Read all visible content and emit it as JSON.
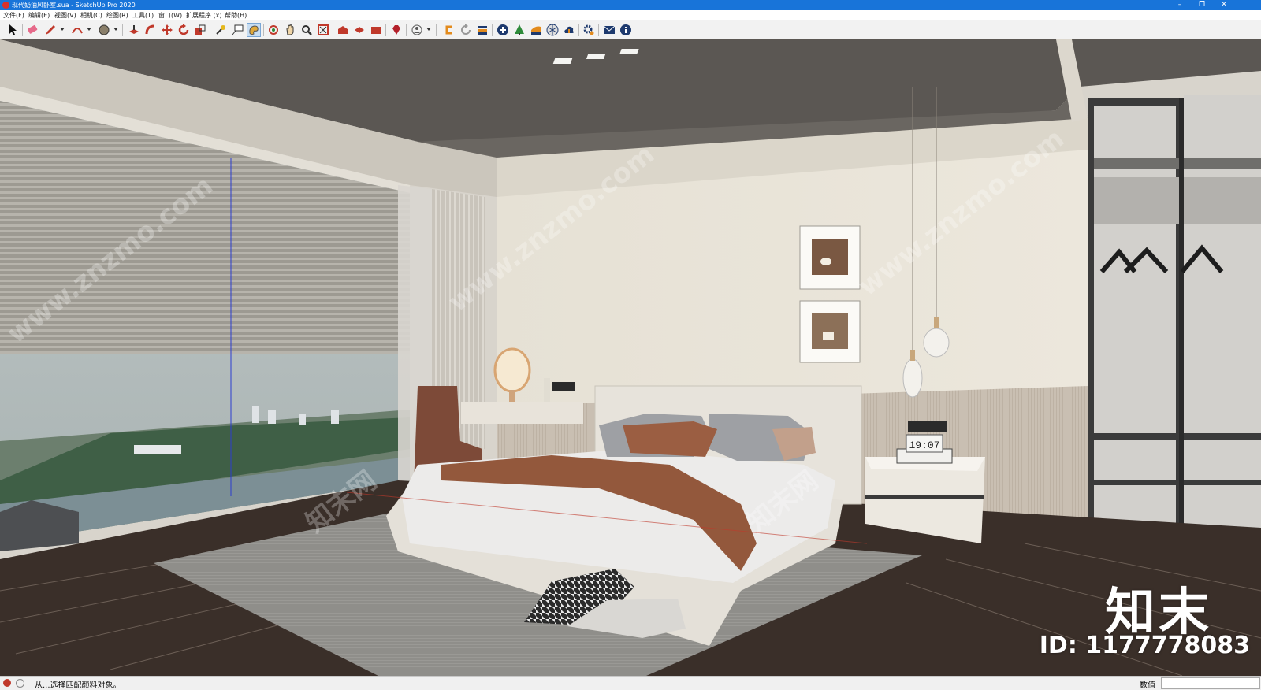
{
  "window": {
    "title": "现代奶油风卧室.sua - SketchUp Pro 2020",
    "controls": {
      "minimize": "–",
      "restore": "❐",
      "close": "✕"
    }
  },
  "menu": {
    "items": [
      "文件(F)",
      "编辑(E)",
      "视图(V)",
      "相机(C)",
      "绘图(R)",
      "工具(T)",
      "窗口(W)",
      "扩展程序 (x)",
      "帮助(H)"
    ]
  },
  "toolbar": {
    "tools": [
      "select-icon",
      "eraser-icon",
      "pencil-icon",
      "arc-icon",
      "paint-bucket-icon",
      "push-pull-icon",
      "follow-me-icon",
      "move-icon",
      "rotate-icon",
      "scale-icon",
      "tape-measure-icon",
      "text-icon",
      "paint-icon",
      "orbit-icon",
      "pan-icon",
      "zoom-icon",
      "zoom-extents-icon",
      "warehouse-icon",
      "components-icon",
      "extension-icon",
      "ruby-icon",
      "user-icon",
      "layout-icon",
      "reload-icon",
      "stack-icon",
      "add-icon",
      "tree-icon",
      "chart-icon",
      "pattern-icon",
      "cloud-upload-icon",
      "settings-icon",
      "mail-icon",
      "info-icon"
    ],
    "active_tool": "paint-icon"
  },
  "viewport": {
    "scene": "现代奶油风卧室",
    "clock_display": "19:07",
    "watermark": {
      "logo": "知末",
      "id": "ID: 1177778083",
      "site": "www.znzmo.com",
      "site_cn": "知末网"
    }
  },
  "status": {
    "message": "从...选择匹配颜料对象。",
    "vcb_label": "数值",
    "vcb_value": ""
  },
  "colors": {
    "titlebar": "#1874d9",
    "ceiling": "#5b5753",
    "wall": "#ede8dc",
    "floor": "#3a2f29",
    "rug": "#8d8c88",
    "blanket": "#93583c",
    "wardrobe": "#3b3b3b"
  }
}
